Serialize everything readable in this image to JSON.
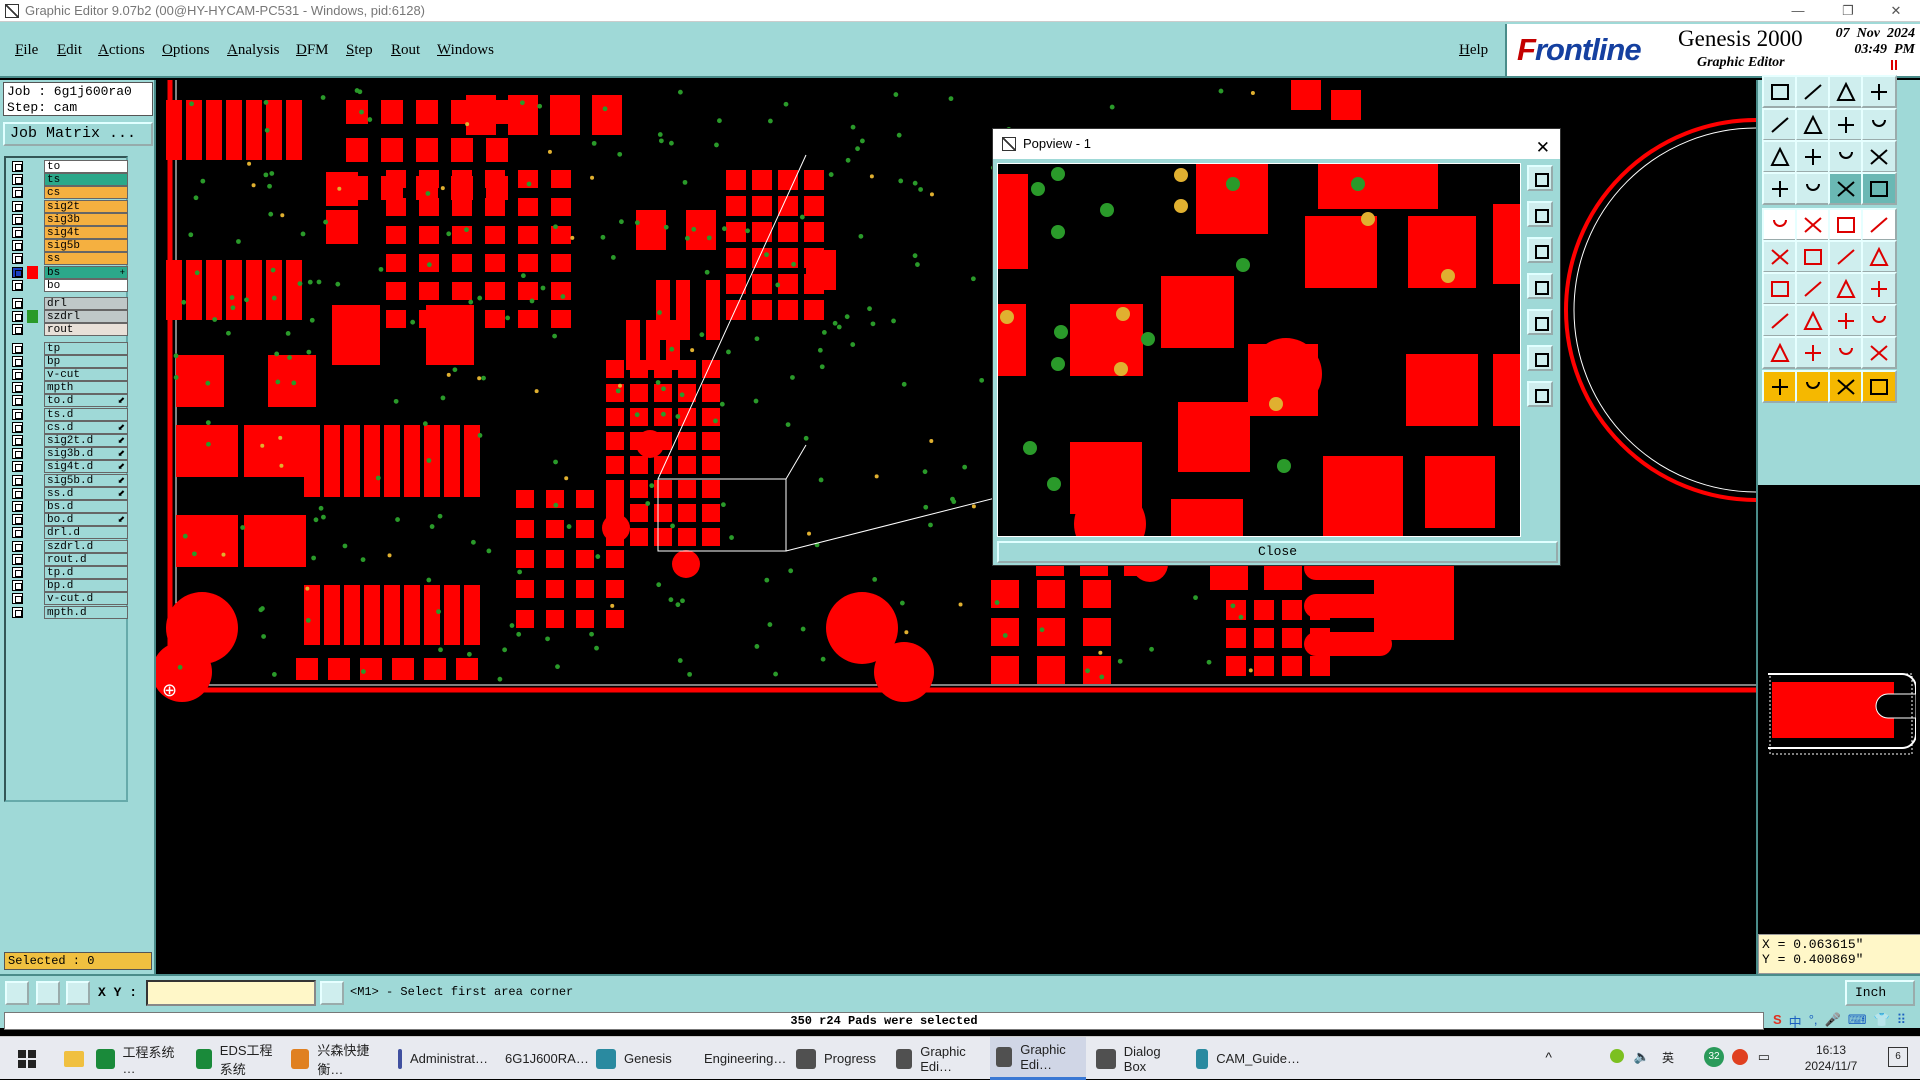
{
  "window": {
    "title": "Graphic Editor 9.07b2 (00@HY-HYCAM-PC531 - Windows, pid:6128)",
    "controls": [
      "—",
      "❐",
      "✕"
    ]
  },
  "menubar": {
    "items": [
      "File",
      "Edit",
      "Actions",
      "Options",
      "Analysis",
      "DFM",
      "Step",
      "Rout",
      "Windows"
    ],
    "help": "Help"
  },
  "logo": {
    "brand_first": "F",
    "brand_rest": "rontline",
    "product": "Genesis 2000",
    "subtitle": "Graphic Editor",
    "datetime": "07  Nov  2024\n03:49  PM"
  },
  "job": {
    "job_line": "Job  : 6g1j600ra0",
    "step_line": "Step: cam",
    "matrix_button": "Job Matrix ..."
  },
  "layers": [
    {
      "name": "to",
      "bg": "#ffffff",
      "color": "",
      "arrow": ""
    },
    {
      "name": "ts",
      "bg": "#2ba88a",
      "color": "",
      "arrow": ""
    },
    {
      "name": "cs",
      "bg": "#f5b040",
      "color": "",
      "arrow": ""
    },
    {
      "name": "sig2t",
      "bg": "#f5b040",
      "color": "",
      "arrow": ""
    },
    {
      "name": "sig3b",
      "bg": "#f5b040",
      "color": "",
      "arrow": ""
    },
    {
      "name": "sig4t",
      "bg": "#f5b040",
      "color": "",
      "arrow": ""
    },
    {
      "name": "sig5b",
      "bg": "#f5b040",
      "color": "",
      "arrow": ""
    },
    {
      "name": "ss",
      "bg": "#f5b040",
      "color": "",
      "arrow": ""
    },
    {
      "name": "bs",
      "bg": "#2ba88a",
      "color": "#ff0000",
      "arrow": "+",
      "active": true
    },
    {
      "name": "bo",
      "bg": "#ffffff",
      "color": "",
      "arrow": ""
    },
    {
      "name": "drl",
      "bg": "#bfc8c8",
      "color": "",
      "arrow": ""
    },
    {
      "name": "szdrl",
      "bg": "#bfc8c8",
      "color": "#2a9a2a",
      "arrow": ""
    },
    {
      "name": "rout",
      "bg": "#e8e0d8",
      "color": "",
      "arrow": ""
    },
    {
      "name": "tp",
      "bg": "#9fd9d7",
      "color": "",
      "arrow": ""
    },
    {
      "name": "bp",
      "bg": "#9fd9d7",
      "color": "",
      "arrow": ""
    },
    {
      "name": "v-cut",
      "bg": "#9fd9d7",
      "color": "",
      "arrow": ""
    },
    {
      "name": "mpth",
      "bg": "#9fd9d7",
      "color": "",
      "arrow": ""
    },
    {
      "name": "to.d",
      "bg": "#9fd9d7",
      "color": "",
      "arrow": "⬋"
    },
    {
      "name": "ts.d",
      "bg": "#9fd9d7",
      "color": "",
      "arrow": ""
    },
    {
      "name": "cs.d",
      "bg": "#9fd9d7",
      "color": "",
      "arrow": "⬋"
    },
    {
      "name": "sig2t.d",
      "bg": "#9fd9d7",
      "color": "",
      "arrow": "⬋"
    },
    {
      "name": "sig3b.d",
      "bg": "#9fd9d7",
      "color": "",
      "arrow": "⬋"
    },
    {
      "name": "sig4t.d",
      "bg": "#9fd9d7",
      "color": "",
      "arrow": "⬋"
    },
    {
      "name": "sig5b.d",
      "bg": "#9fd9d7",
      "color": "",
      "arrow": "⬋"
    },
    {
      "name": "ss.d",
      "bg": "#9fd9d7",
      "color": "",
      "arrow": "⬋"
    },
    {
      "name": "bs.d",
      "bg": "#9fd9d7",
      "color": "",
      "arrow": ""
    },
    {
      "name": "bo.d",
      "bg": "#9fd9d7",
      "color": "",
      "arrow": "⬋"
    },
    {
      "name": "drl.d",
      "bg": "#9fd9d7",
      "color": "",
      "arrow": ""
    },
    {
      "name": "szdrl.d",
      "bg": "#9fd9d7",
      "color": "",
      "arrow": ""
    },
    {
      "name": "rout.d",
      "bg": "#9fd9d7",
      "color": "",
      "arrow": ""
    },
    {
      "name": "tp.d",
      "bg": "#9fd9d7",
      "color": "",
      "arrow": ""
    },
    {
      "name": "bp.d",
      "bg": "#9fd9d7",
      "color": "",
      "arrow": ""
    },
    {
      "name": "v-cut.d",
      "bg": "#9fd9d7",
      "color": "",
      "arrow": ""
    },
    {
      "name": "mpth.d",
      "bg": "#9fd9d7",
      "color": "",
      "arrow": ""
    }
  ],
  "selection": {
    "text": "Selected : 0"
  },
  "popview": {
    "title": "Popview - 1",
    "close_button": "Close"
  },
  "coords": {
    "x": "X = 0.063615\"",
    "y": "Y = 0.400869\""
  },
  "commandline": {
    "xy_label": "X Y :",
    "xy_value": "",
    "prompt": "<M1> - Select first area corner",
    "unit": "Inch"
  },
  "message": "350 r24 Pads were selected",
  "ime": [
    "S",
    "中",
    "°,",
    "🎤",
    "⌨",
    "👕",
    "⠿"
  ],
  "colors": {
    "panel": "#9fd9d7",
    "pad": "#ff0000",
    "via": "#2a9a2a",
    "drill": "#e0b030",
    "selected_layer": "#f0c040"
  },
  "taskbar": {
    "tasks": [
      {
        "label": "工程系统  …",
        "icon_color": "#1a8a3a"
      },
      {
        "label": "EDS工程系统",
        "icon_color": "#1a8a3a"
      },
      {
        "label": "兴森快捷衡…",
        "icon_color": "#e08020"
      },
      {
        "label": "Administrat…",
        "icon_color": "#4050a0"
      },
      {
        "label": "6G1J600RA…",
        "icon_color": "#303030"
      },
      {
        "label": "Genesis",
        "icon_color": "#2a8aa0"
      },
      {
        "label": "Engineering…",
        "icon_color": "#505050"
      },
      {
        "label": "Progress",
        "icon_color": "#505050"
      },
      {
        "label": "Graphic Edi…",
        "icon_color": "#505050"
      },
      {
        "label": "Graphic Edi…",
        "icon_color": "#505050",
        "active": true
      },
      {
        "label": "Dialog Box",
        "icon_color": "#505050"
      },
      {
        "label": "CAM_Guide…",
        "icon_color": "#2a8aa0"
      }
    ],
    "tray_lang": "英",
    "tray_badge": "32",
    "time": "16:13",
    "date": "2024/11/7",
    "notif_count": "6"
  }
}
